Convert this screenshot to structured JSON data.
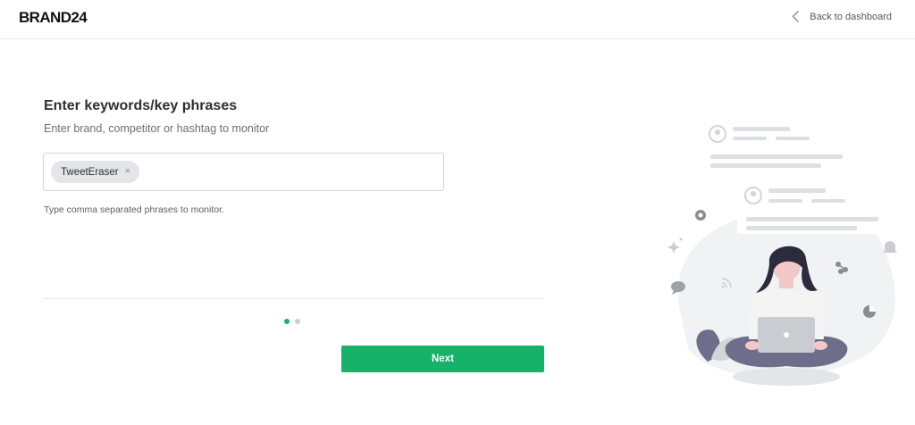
{
  "header": {
    "logo_text": "BRAND24",
    "back_label": "Back to dashboard"
  },
  "form": {
    "title": "Enter keywords/key phrases",
    "subtitle": "Enter brand, competitor or hashtag to monitor",
    "keywords": [
      {
        "label": "TweetEraser",
        "remove_symbol": "×"
      }
    ],
    "hint": "Type comma separated phrases to monitor.",
    "next_label": "Next"
  },
  "steps": {
    "current": 1,
    "total": 2
  },
  "colors": {
    "accent": "#16b26a",
    "tag_bg": "#e3e5e8",
    "illustration_person_shirt": "#f4f4f5",
    "illustration_person_pants": "#6e6e8a",
    "illustration_person_hair": "#2b2b3b"
  },
  "icons": {
    "back": "chevron-left-icon",
    "tag_remove": "close-icon"
  }
}
